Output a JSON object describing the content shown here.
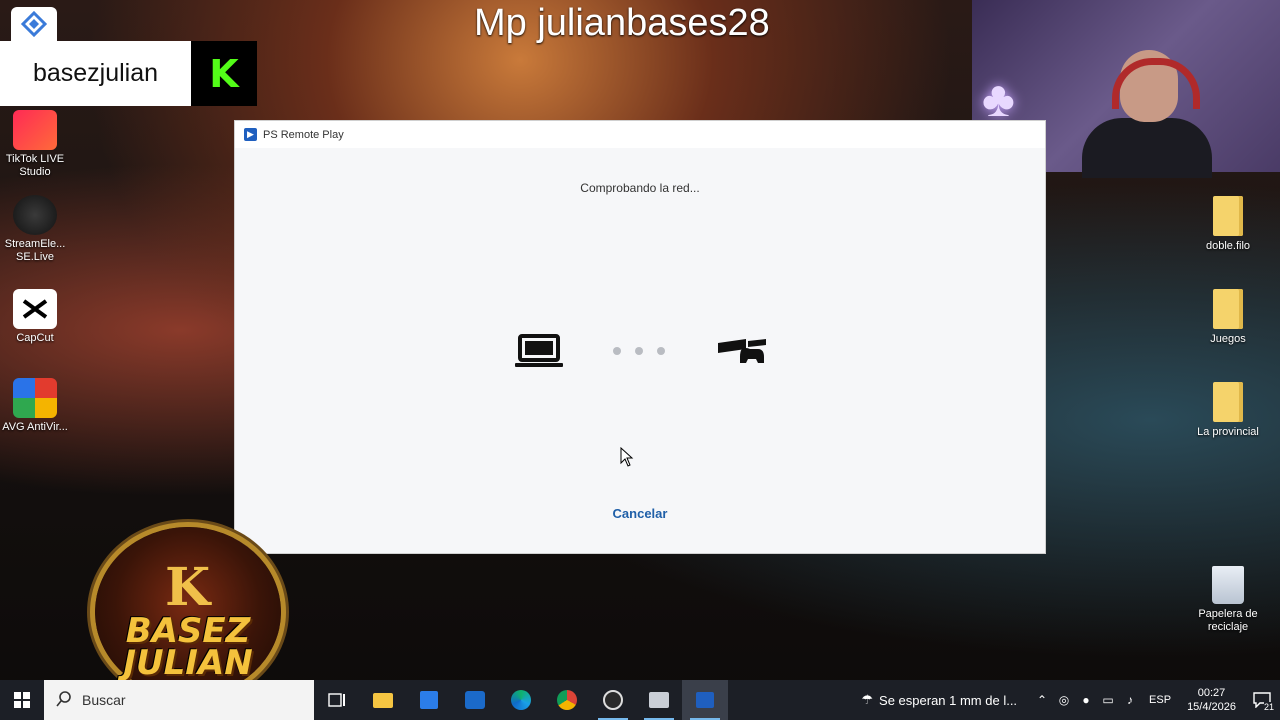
{
  "overlay": {
    "title": "Mp julianbases28",
    "username": "basezjulian",
    "kick_letter": "K"
  },
  "desktop_icons_left": [
    {
      "label": "TikTok LIVE Studio"
    },
    {
      "label": "StreamEle... SE.Live"
    },
    {
      "label": "CapCut"
    },
    {
      "label": "AVG AntiVir..."
    }
  ],
  "desktop_icons_right": [
    {
      "label": "doble.filo"
    },
    {
      "label": "Juegos"
    },
    {
      "label": "La provincial"
    },
    {
      "label": "Papelera de reciclaje"
    }
  ],
  "window": {
    "title": "PS Remote Play",
    "status": "Comprobando la red...",
    "cancel_label": "Cancelar"
  },
  "logo": {
    "letter": "K",
    "line1": "BASEZ",
    "line2": "JULIAN"
  },
  "taskbar": {
    "search_placeholder": "Buscar",
    "weather_text": "Se esperan 1 mm de l...",
    "language": "ESP",
    "time": "00:27",
    "date": "15/4/2026",
    "notification_count": "21"
  },
  "colors": {
    "accent_link": "#1f5fa8",
    "taskbar_bg": "#1c1f26",
    "kick_green": "#53fc18"
  }
}
